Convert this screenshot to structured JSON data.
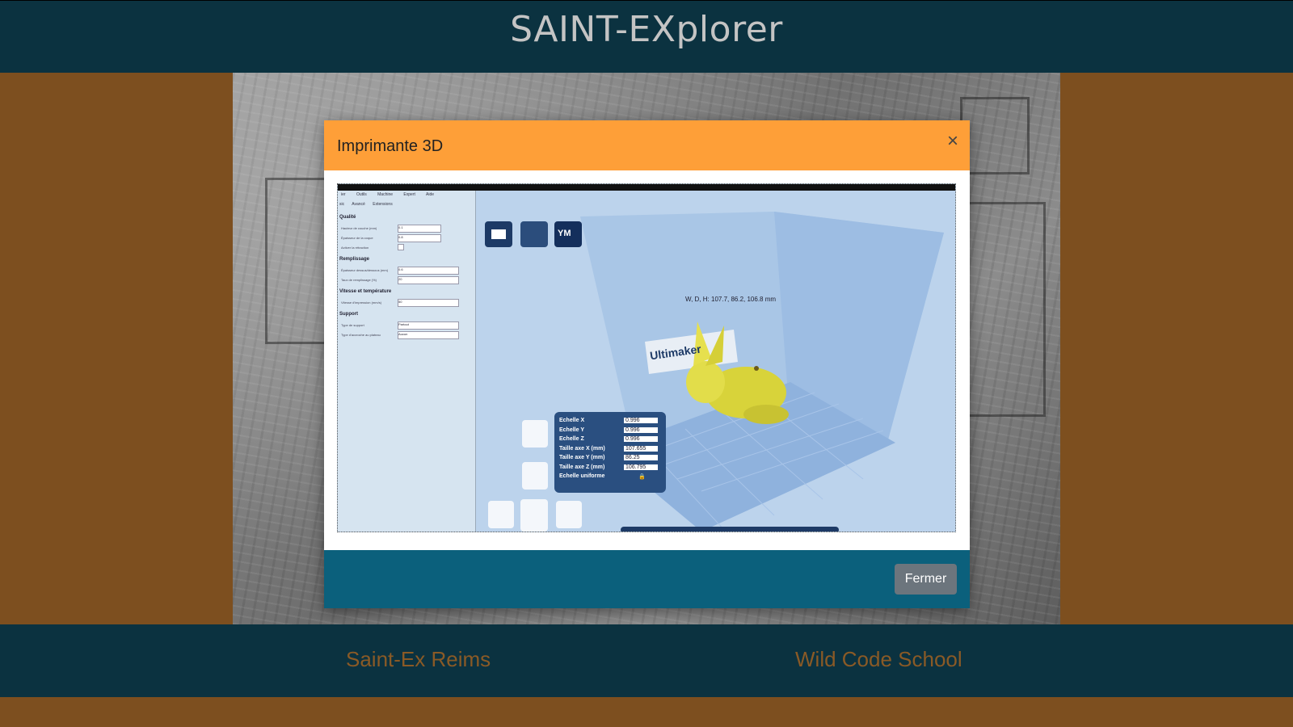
{
  "header": {
    "title": "SAINT-EXplorer"
  },
  "modal": {
    "title": "Imprimante 3D",
    "close_symbol": "×",
    "close_button_label": "Fermer",
    "video": {
      "menu_items": [
        "ier",
        "Outils",
        "Machine",
        "Expert",
        "Aide"
      ],
      "panel_tabs": [
        "sic",
        "Avancé",
        "Extensions"
      ],
      "panel_sections": [
        "Qualité",
        "Remplissage",
        "Vitesse et température",
        "Support"
      ],
      "panel_fields": [
        "Hauteur de couche (mm)",
        "Épaisseur de la coque",
        "Activer la rétraction",
        "Épaisseur dessus/dessous (mm)",
        "Taux de remplissage (%)",
        "Vitesse d'impression (mm/s)",
        "Type de support",
        "Type d'accroche au plateau"
      ],
      "panel_values": [
        "0.1",
        "0.8",
        "",
        "0.6",
        "20",
        "50",
        "Partout",
        "Aucun"
      ],
      "toolbar_logo": "YM",
      "dimensions_text": "W, D, H: 107.7, 86.2, 106.8 mm",
      "printer_brand": "Ultimaker",
      "scale_labels": [
        "Echelle X",
        "Echelle Y",
        "Echelle Z",
        "Taille axe X (mm)",
        "Taille axe Y (mm)",
        "Taille axe Z (mm)",
        "Echelle uniforme"
      ],
      "scale_values": [
        "0.996",
        "0.996",
        "0.996",
        "107.655",
        "86.25",
        "106.795"
      ]
    }
  },
  "footer": {
    "links": [
      "Saint-Ex Reims",
      "Wild Code School"
    ]
  },
  "colors": {
    "page_background": "#7d4f1f",
    "header_background": "#0b3240",
    "modal_header": "#fe9f38",
    "modal_footer": "#0b607c",
    "button": "#6c757d",
    "footer_link": "#8a5a26"
  }
}
